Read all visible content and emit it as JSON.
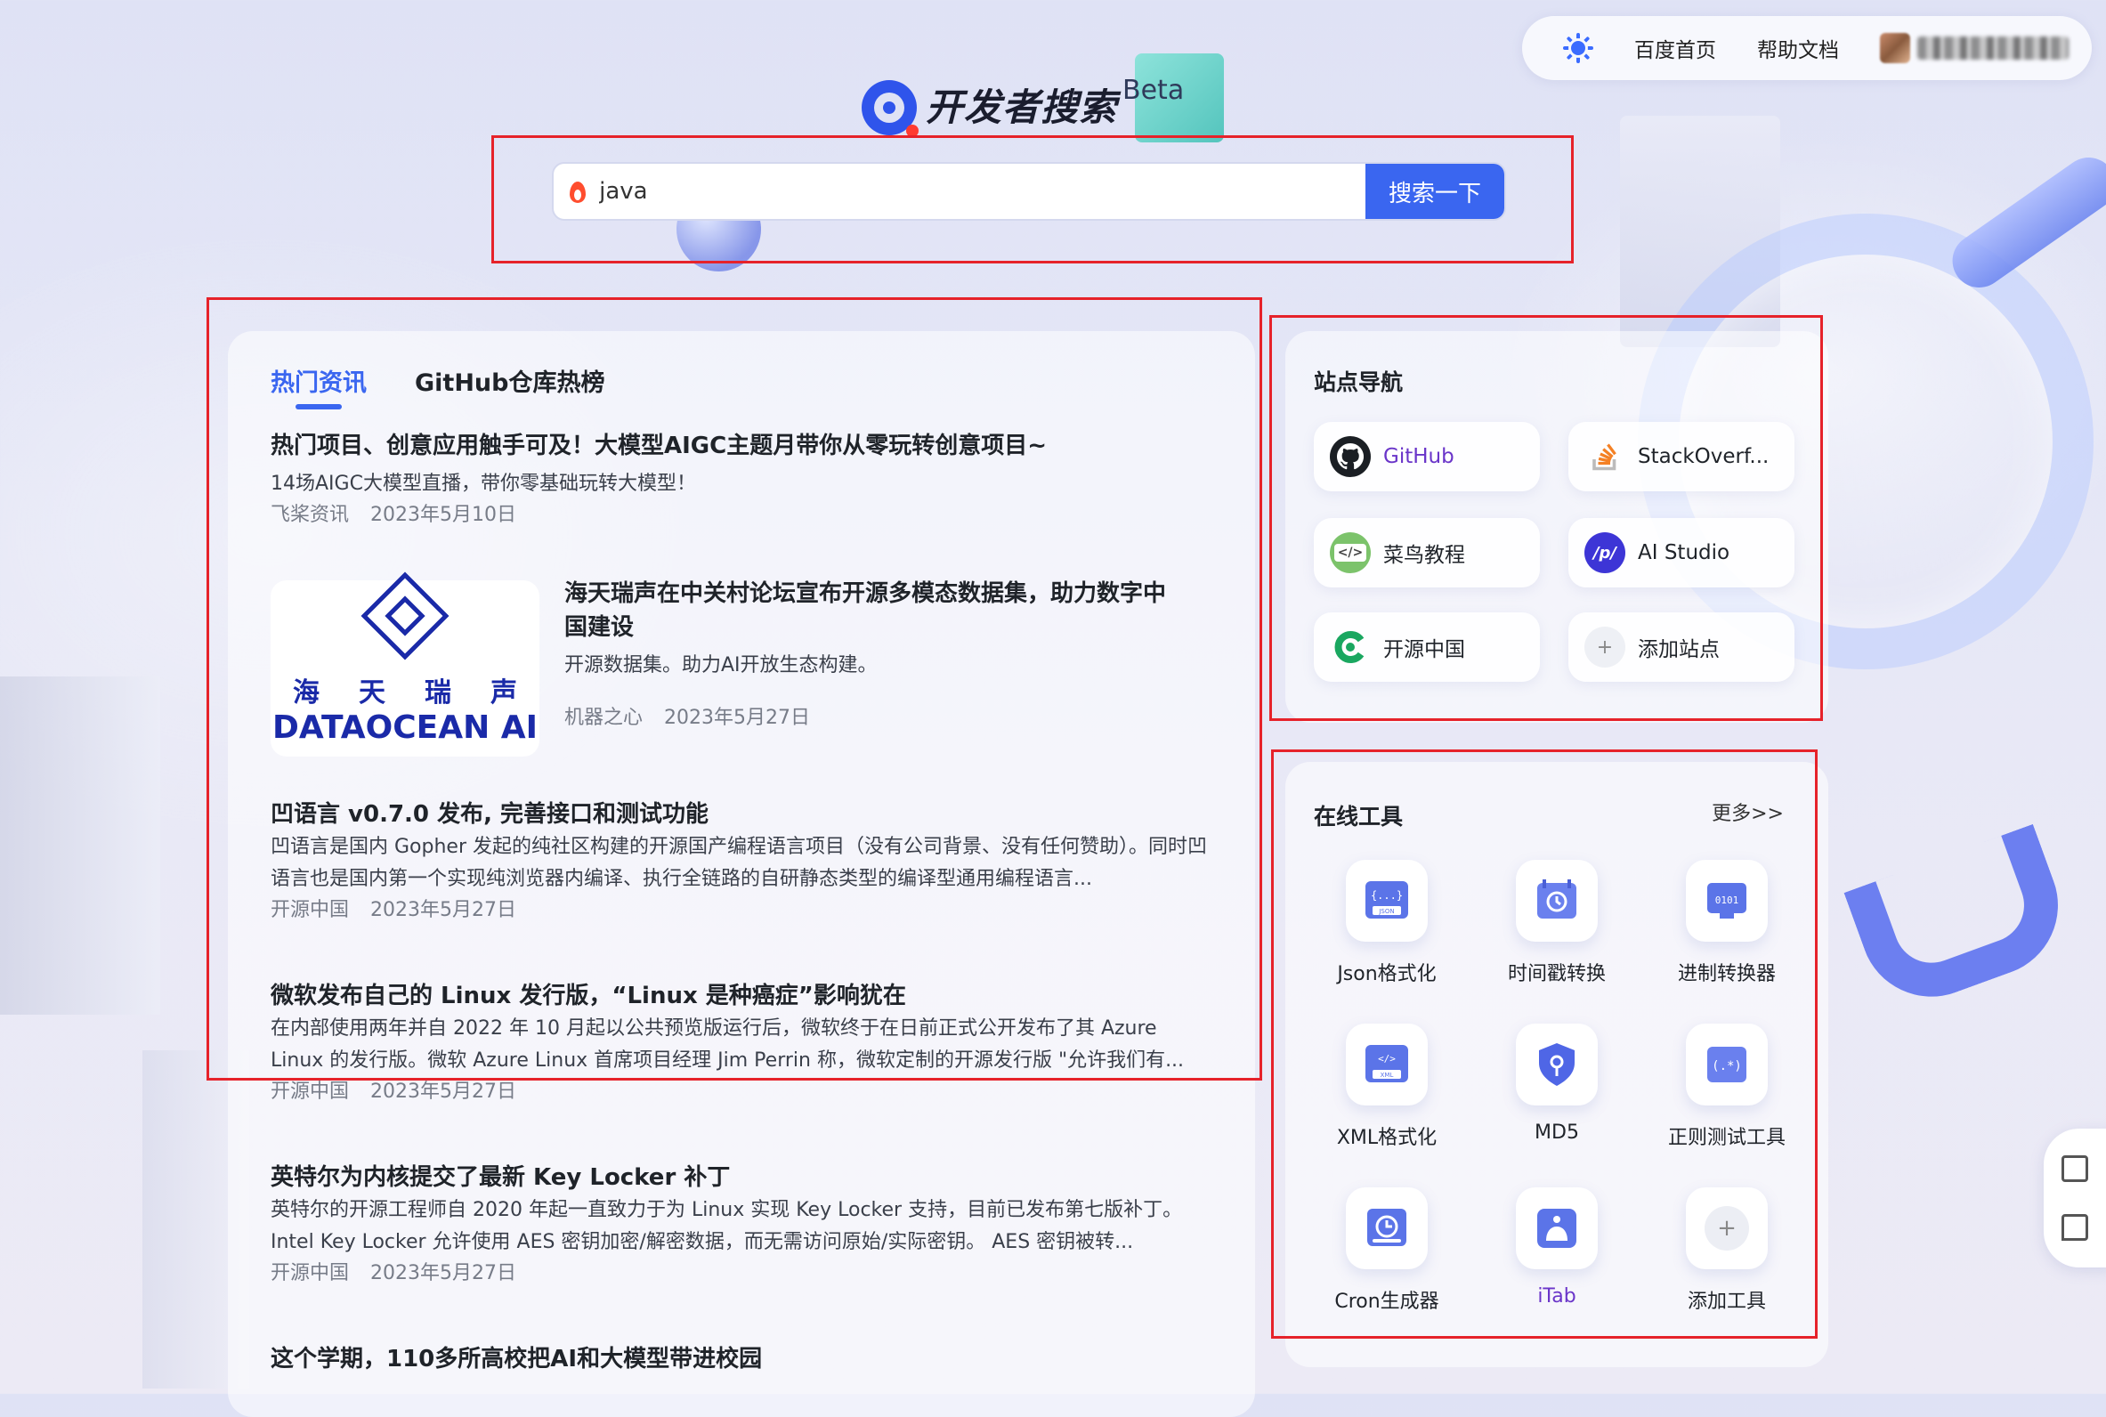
{
  "topbar": {
    "links": [
      "百度首页",
      "帮助文档"
    ]
  },
  "logo": {
    "text": "开发者搜索",
    "badge": "Beta"
  },
  "search": {
    "value": "java",
    "button_label": "搜索一下"
  },
  "news": {
    "tabs": [
      {
        "label": "热门资讯",
        "active": true
      },
      {
        "label": "GitHub仓库热榜",
        "active": false
      }
    ],
    "items": [
      {
        "title": "热门项目、创意应用触手可及！大模型AIGC主题月带你从零玩转创意项目~",
        "desc": "14场AIGC大模型直播，带你零基础玩转大模型！",
        "source": "飞桨资讯",
        "date": "2023年5月10日"
      },
      {
        "title": "海天瑞声在中关村论坛宣布开源多模态数据集，助力数字中国建设",
        "desc": "开源数据集。助力AI开放生态构建。",
        "source": "机器之心",
        "date": "2023年5月27日",
        "thumb_cn": "海天瑞声",
        "thumb_en": "DATAOCEAN AI"
      },
      {
        "title": "凹语言 v0.7.0 发布, 完善接口和测试功能",
        "desc": "凹语言是国内 Gopher 发起的纯社区构建的开源国产编程语言项目（没有公司背景、没有任何赞助）。同时凹语言也是国内第一个实现纯浏览器内编译、执行全链路的自研静态类型的编译型通用编程语言...",
        "source": "开源中国",
        "date": "2023年5月27日"
      },
      {
        "title": "微软发布自己的 Linux 发行版，“Linux 是种癌症”影响犹在",
        "desc": "在内部使用两年并自 2022 年 10 月起以公共预览版运行后，微软终于在日前正式公开发布了其 Azure Linux 的发行版。微软 Azure Linux 首席项目经理 Jim Perrin 称，微软定制的开源发行版 \"允许我们有...",
        "source": "开源中国",
        "date": "2023年5月27日"
      },
      {
        "title": "英特尔为内核提交了最新 Key Locker 补丁",
        "desc": "英特尔的开源工程师自 2020 年起一直致力于为 Linux 实现 Key Locker 支持，目前已发布第七版补丁。 Intel Key Locker 允许使用 AES 密钥加密/解密数据，而无需访问原始/实际密钥。 AES 密钥被转...",
        "source": "开源中国",
        "date": "2023年5月27日"
      },
      {
        "title": "这个学期，110多所高校把AI和大模型带进校园",
        "desc": "",
        "source": "",
        "date": ""
      }
    ]
  },
  "site_nav": {
    "title": "站点导航",
    "items": [
      {
        "label": "GitHub",
        "icon": "github-icon"
      },
      {
        "label": "StackOverf...",
        "icon": "stackoverflow-icon"
      },
      {
        "label": "菜鸟教程",
        "icon": "runoob-icon"
      },
      {
        "label": "AI Studio",
        "icon": "aistudio-icon"
      },
      {
        "label": "开源中国",
        "icon": "oschina-icon"
      },
      {
        "label": "添加站点",
        "icon": "add-icon"
      }
    ]
  },
  "tools": {
    "title": "在线工具",
    "more_label": "更多>>",
    "items": [
      {
        "label": "Json格式化",
        "icon": "json-icon"
      },
      {
        "label": "时间戳转换",
        "icon": "timestamp-icon"
      },
      {
        "label": "进制转换器",
        "icon": "binary-icon"
      },
      {
        "label": "XML格式化",
        "icon": "xml-icon"
      },
      {
        "label": "MD5",
        "icon": "shield-key-icon"
      },
      {
        "label": "正则测试工具",
        "icon": "regex-icon"
      },
      {
        "label": "Cron生成器",
        "icon": "clock-icon"
      },
      {
        "label": "iTab",
        "icon": "itab-icon"
      },
      {
        "label": "添加工具",
        "icon": "add-icon"
      }
    ]
  },
  "colors": {
    "accent": "#3a66f0",
    "annotation_red": "#e6222a",
    "purple_link": "#6a35c9"
  }
}
